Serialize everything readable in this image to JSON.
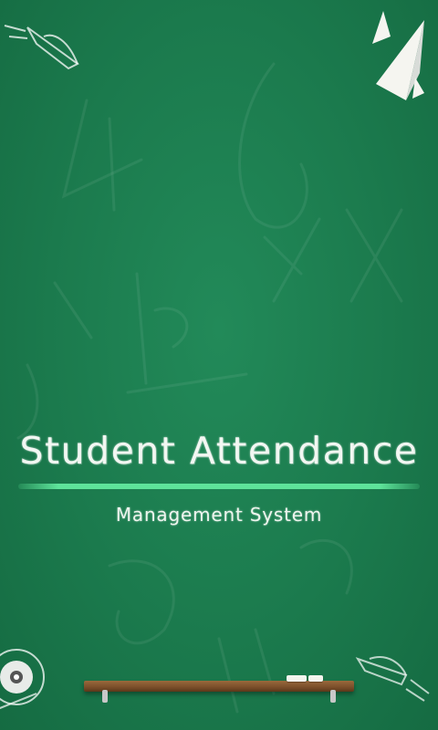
{
  "splash": {
    "title": "Student Attendance",
    "subtitle": "Management System"
  },
  "icons": {
    "top_left": "rocket-doodle-icon",
    "top_right": "paper-plane-icon",
    "bottom_left": "planet-doodle-icon",
    "bottom_right": "rocket-doodle-icon"
  },
  "colors": {
    "board": "#1b7a4d",
    "underline": "#5ee39a",
    "chalk_text": "#f2f7f2",
    "shelf": "#7a4e2a"
  }
}
